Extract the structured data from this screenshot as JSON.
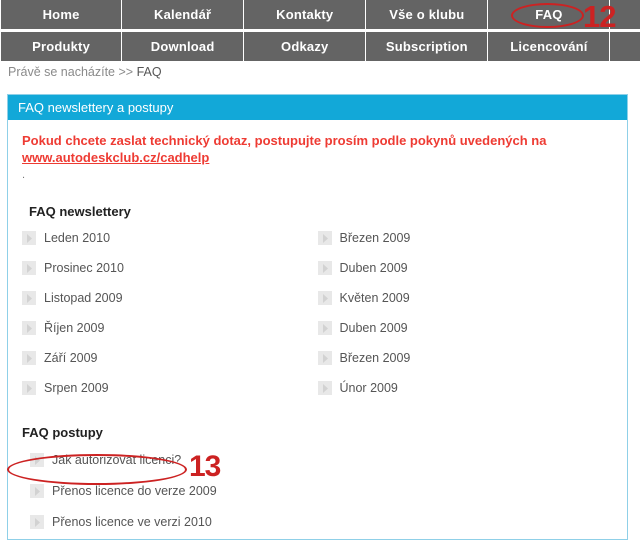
{
  "nav": {
    "row1": [
      {
        "label": "Home"
      },
      {
        "label": "Kalendář"
      },
      {
        "label": "Kontakty"
      },
      {
        "label": "Vše o klubu"
      },
      {
        "label": "FAQ"
      }
    ],
    "row2": [
      {
        "label": "Produkty"
      },
      {
        "label": "Download"
      },
      {
        "label": "Odkazy"
      },
      {
        "label": "Subscription"
      },
      {
        "label": "Licencování"
      }
    ]
  },
  "breadcrumb": {
    "prefix": "Právě se nacházíte >> ",
    "current": "FAQ"
  },
  "panel": {
    "header": "FAQ newslettery a postupy",
    "notice": {
      "text": "Pokud chcete zaslat technický dotaz, postupujte prosím podle pokynů uvedených na",
      "link": "www.autodeskclub.cz/cadhelp",
      "dot": "."
    },
    "newsletters": {
      "title": "FAQ newslettery",
      "left": [
        {
          "label": "Leden 2010"
        },
        {
          "label": "Prosinec 2010"
        },
        {
          "label": "Listopad 2009"
        },
        {
          "label": "Říjen 2009"
        },
        {
          "label": "Září 2009"
        },
        {
          "label": "Srpen 2009"
        }
      ],
      "right": [
        {
          "label": "Březen 2009"
        },
        {
          "label": "Duben 2009"
        },
        {
          "label": "Květen 2009"
        },
        {
          "label": "Duben 2009"
        },
        {
          "label": "Březen 2009"
        },
        {
          "label": "Únor 2009"
        }
      ]
    },
    "postupy": {
      "title": "FAQ postupy",
      "items": [
        {
          "label": "Jak autorizovat licenci?"
        },
        {
          "label": "Přenos licence do verze 2009"
        },
        {
          "label": "Přenos licence ve verzi 2010"
        }
      ]
    }
  },
  "annotations": {
    "faq_number": "12",
    "autorizovat_number": "13"
  },
  "colors": {
    "nav_bg": "#646464",
    "panel_accent": "#12a8d8",
    "panel_border": "#8fd0e8",
    "notice_red": "#ee3b33",
    "annotation_red": "#cc2222",
    "bullet_gray": "#e8e8e8",
    "text_gray": "#555555"
  },
  "icons": {
    "bullet": "chevron-right-icon"
  }
}
